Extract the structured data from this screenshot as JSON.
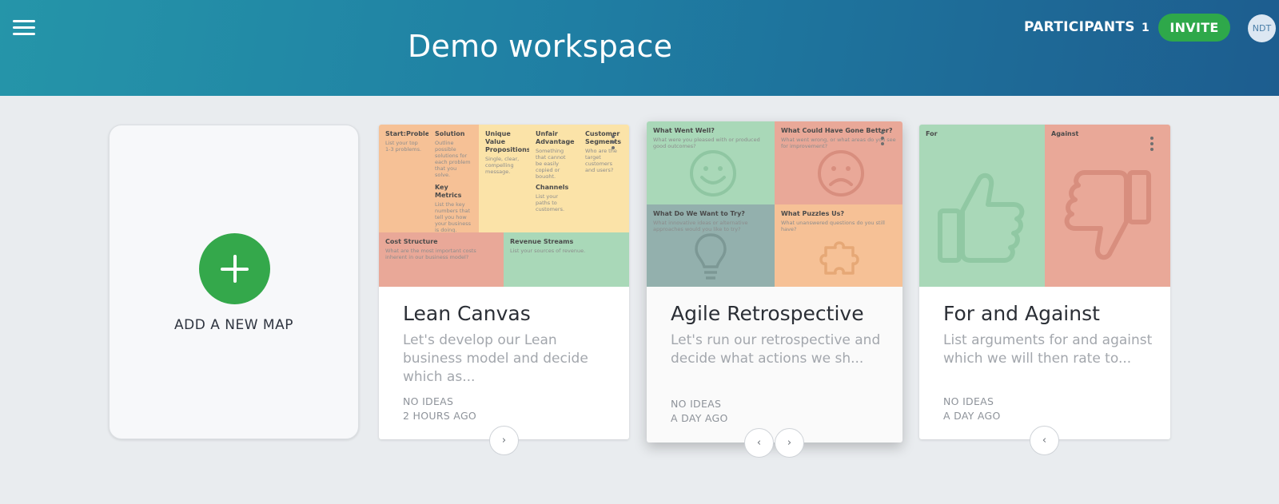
{
  "header": {
    "workspace_title": "Demo workspace",
    "participants_label": "PARTICIPANTS",
    "participants_count": "1",
    "invite_label": "INVITE",
    "avatar_initials": "NDT"
  },
  "add_card": {
    "label": "ADD A NEW MAP"
  },
  "cards": [
    {
      "title": "Lean Canvas",
      "description": "Let's develop our Lean business model and decide which as...",
      "ideas": "NO IDEAS",
      "time": "2 HOURS AGO",
      "thumb": {
        "problem": {
          "title": "Start:Problem",
          "desc": "List your top 1-3 problems."
        },
        "solution": {
          "title": "Solution",
          "desc": "Outline possible solutions for each problem that you solve."
        },
        "key_metrics": {
          "title": "Key Metrics",
          "desc": "List the key numbers that tell you how your business is doing."
        },
        "uvp": {
          "title": "Unique Value Propositions",
          "desc": "Single, clear, compelling message."
        },
        "unfair": {
          "title": "Unfair Advantage",
          "desc": "Something that cannot be easily copied or bought."
        },
        "channels": {
          "title": "Channels",
          "desc": "List your paths to customers."
        },
        "segments": {
          "title": "Customer Segments",
          "desc": "Who are the target customers and users?"
        },
        "cost": {
          "title": "Cost Structure",
          "desc": "What are the most important costs inherent in our business model?"
        },
        "revenue": {
          "title": "Revenue Streams",
          "desc": "List your sources of revenue."
        }
      }
    },
    {
      "title": "Agile Retrospective",
      "description": "Let's run our retrospective and decide what actions we sh...",
      "ideas": "NO IDEAS",
      "time": "A DAY AGO",
      "thumb": {
        "well": {
          "title": "What Went Well?",
          "desc": "What were you pleased with or produced good outcomes?"
        },
        "better": {
          "title": "What Could Have Gone Better?",
          "desc": "What went wrong, or what areas do you see for improvement?"
        },
        "try": {
          "title": "What Do We Want to Try?",
          "desc": "What innovative ideas or alternative approaches would you like to try?"
        },
        "puzzles": {
          "title": "What Puzzles Us?",
          "desc": "What unanswered questions do you still have?"
        }
      }
    },
    {
      "title": "For and Against",
      "description": "List arguments for and against which we will then rate to...",
      "ideas": "NO IDEAS",
      "time": "A DAY AGO",
      "thumb": {
        "for": {
          "title": "For"
        },
        "against": {
          "title": "Against"
        }
      }
    }
  ],
  "nav": {
    "next": "›",
    "prev": "‹"
  },
  "colors": {
    "accent_green": "#2ea84a",
    "orange": "#f6c196",
    "yellow": "#fbe3a8",
    "red": "#e9a898",
    "green": "#a9d8b8",
    "teal": "#93b0ad"
  }
}
